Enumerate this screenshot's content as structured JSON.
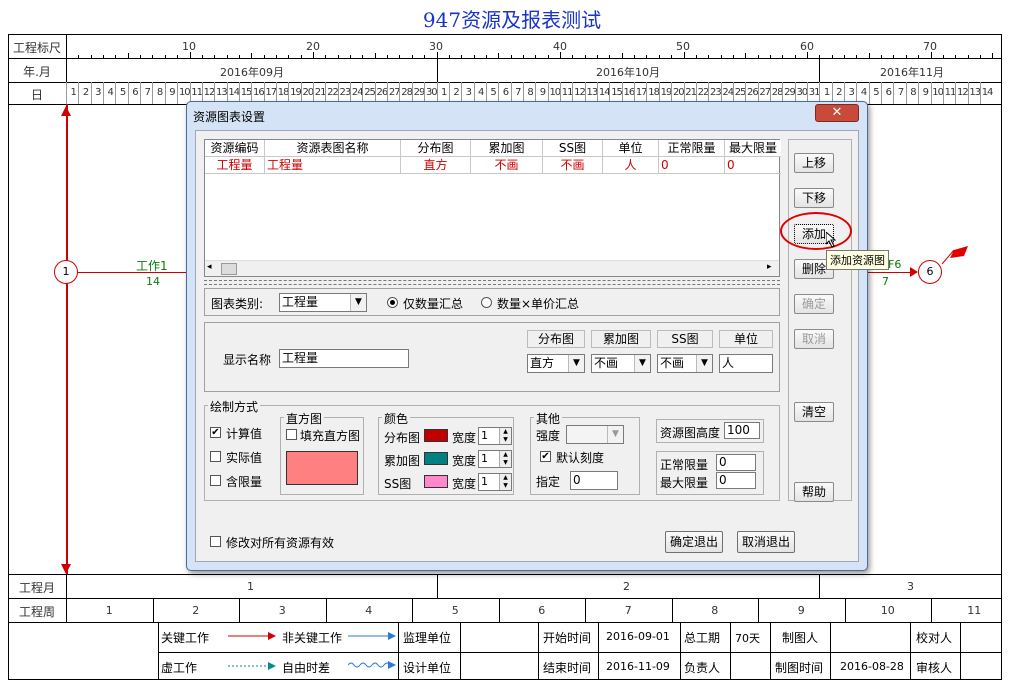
{
  "title": "947资源及报表测试",
  "ruler": {
    "label": "工程标尺",
    "ticks": [
      "10",
      "20",
      "30",
      "40",
      "50",
      "60",
      "70"
    ]
  },
  "month_row": {
    "label": "年.月",
    "months": [
      "2016年09月",
      "2016年10月",
      "2016年11月"
    ]
  },
  "day_row": {
    "label": "日"
  },
  "network": {
    "node1": "1",
    "node6": "6",
    "task_label": "工作1",
    "task_duration": "14",
    "right_task_label": "F6",
    "right_task_duration": "7"
  },
  "bottom": {
    "month_label": "工程月",
    "months": [
      "1",
      "2",
      "3"
    ],
    "week_label": "工程周",
    "weeks": [
      "1",
      "2",
      "3",
      "4",
      "5",
      "6",
      "7",
      "8",
      "9",
      "10",
      "11"
    ]
  },
  "legend": {
    "critical": "关键工作",
    "noncritical": "非关键工作",
    "dummy": "虚工作",
    "free_float": "自由时差",
    "supervisor": "监理单位",
    "designer": "设计单位",
    "start_label": "开始时间",
    "start_value": "2016-09-01",
    "end_label": "结束时间",
    "end_value": "2016-11-09",
    "total_label": "总工期",
    "total_value": "70天",
    "owner_label": "负责人",
    "drawer_label": "制图人",
    "draw_time_label": "制图时间",
    "draw_time_value": "2016-08-28",
    "checker_label": "校对人",
    "reviewer_label": "审核人"
  },
  "dialog": {
    "title": "资源图表设置",
    "close": "✕",
    "grid": {
      "headers": [
        "资源编码",
        "资源表图名称",
        "分布图",
        "累加图",
        "SS图",
        "单位",
        "正常限量",
        "最大限量"
      ],
      "rows": [
        [
          "工程量",
          "工程量",
          "直方",
          "不画",
          "不画",
          "人",
          "0",
          "0"
        ]
      ]
    },
    "buttons": {
      "up": "上移",
      "down": "下移",
      "add": "添加",
      "delete": "删除",
      "ok": "确定",
      "cancel": "取消",
      "clear": "清空",
      "help": "帮助",
      "confirm_exit": "确定退出",
      "cancel_exit": "取消退出"
    },
    "tooltip": "添加资源图",
    "chart_type_label": "图表类别:",
    "chart_type_value": "工程量",
    "radio_qty": "仅数量汇总",
    "radio_price": "数量×单价汇总",
    "display_name_label": "显示名称",
    "display_name_value": "工程量",
    "col_dist": "分布图",
    "col_accum": "累加图",
    "col_ss": "SS图",
    "col_unit": "单位",
    "dist_value": "直方",
    "accum_value": "不画",
    "ss_value": "不画",
    "unit_value": "人",
    "draw_mode": "绘制方式",
    "calc_value": "计算值",
    "actual_value": "实际值",
    "with_limit": "含限量",
    "histogram": "直方图",
    "fill_histogram": "填充直方图",
    "color": "颜色",
    "color_dist": "分布图",
    "color_accum": "累加图",
    "color_ss": "SS图",
    "width_label": "宽度",
    "width_values": [
      "1",
      "1",
      "1"
    ],
    "colors": {
      "dist": "#c00000",
      "accum": "#008080",
      "ss": "#ff88cc",
      "fill": "#ff8080"
    },
    "other": "其他",
    "strength": "强度",
    "default_scale": "默认刻度",
    "specify": "指定",
    "specify_value": "0",
    "height_label": "资源图高度",
    "height_value": "100",
    "normal_limit": "正常限量",
    "normal_value": "0",
    "max_limit": "最大限量",
    "max_value": "0",
    "apply_all": "修改对所有资源有效"
  }
}
